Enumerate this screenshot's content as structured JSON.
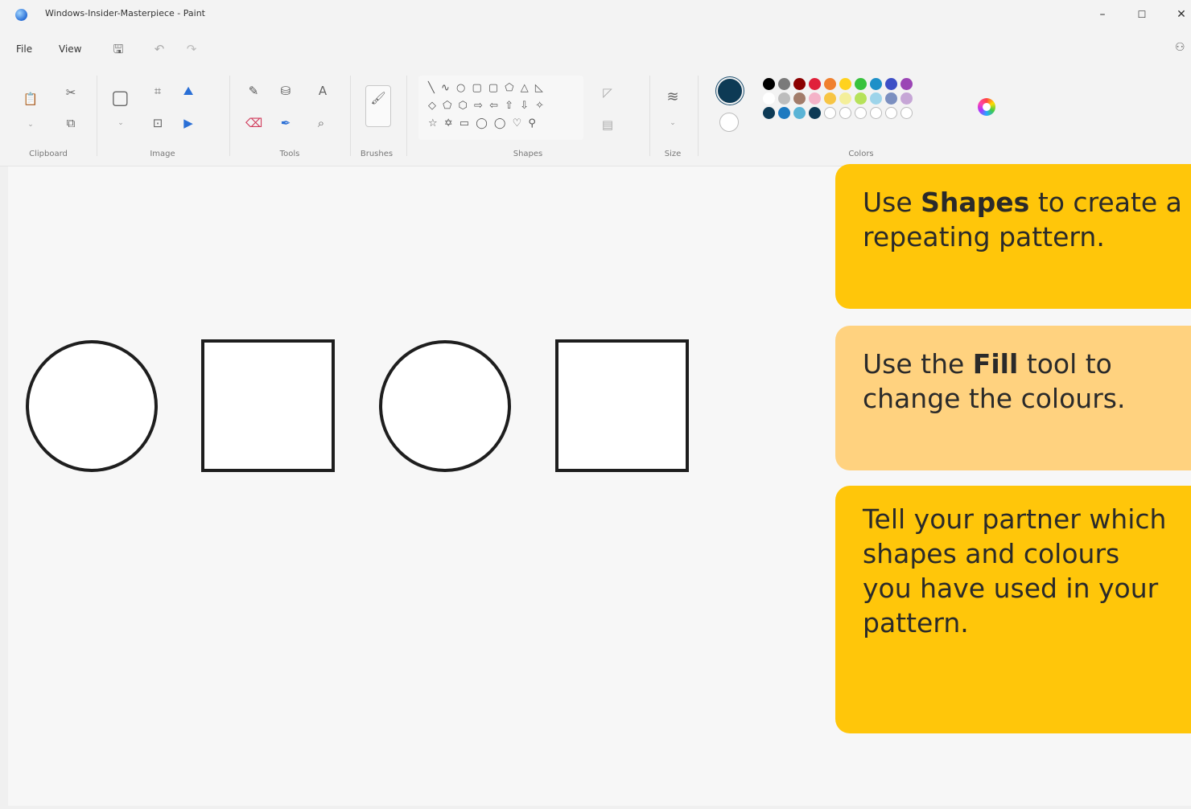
{
  "window": {
    "title": "Windows-Insider-Masterpiece - Paint",
    "controls": {
      "minimize": "–",
      "maximize": "☐",
      "close": "✕"
    }
  },
  "menu": {
    "file": "File",
    "view": "View"
  },
  "ribbon": {
    "groups": {
      "clipboard": "Clipboard",
      "image": "Image",
      "tools": "Tools",
      "brushes": "Brushes",
      "shapes": "Shapes",
      "size": "Size",
      "colors": "Colors"
    },
    "tools_text_glyph": "A",
    "shapes_rows": [
      "╲ ∿ ○ ▢ ▢ ⬠ △ ◺",
      "◇ ⬠ ⬡ ⇨ ⇦ ⇧ ⇩ ✧",
      "☆ ✡ ▭ ◯ ◯ ♡ ⚲"
    ],
    "current_color": "#0d3a55",
    "secondary_color": "#ffffff",
    "palette": [
      [
        "#000000",
        "#7a7a7a",
        "#8b0000",
        "#e0203a",
        "#f0802e",
        "#ffd21e",
        "#38c23d",
        "#1e90c8",
        "#3d4fc6",
        "#9b45b5"
      ],
      [
        "#ffffff",
        "#bdbdbd",
        "#a27c6a",
        "#f4b3c8",
        "#f7c544",
        "#f4ef9a",
        "#b6e25a",
        "#9dd4ea",
        "#7b8fc0",
        "#c6a6d6"
      ],
      [
        "#0d3a55",
        "#1c79c0",
        "#5ab4d6",
        "#0d3a55",
        "",
        "",
        "",
        "",
        "",
        ""
      ]
    ]
  },
  "canvas": {
    "pattern": [
      "circle",
      "square",
      "circle",
      "square"
    ]
  },
  "instructions": [
    {
      "pre": "Use ",
      "bold": "Shapes",
      "post": " to create a",
      "line2": "repeating pattern."
    },
    {
      "pre": "Use the ",
      "bold": "Fill",
      "post": " tool to",
      "line2": "change the colours."
    },
    {
      "lines": [
        "Tell your partner which",
        "shapes and colours",
        "you have used in your",
        "pattern."
      ]
    }
  ]
}
